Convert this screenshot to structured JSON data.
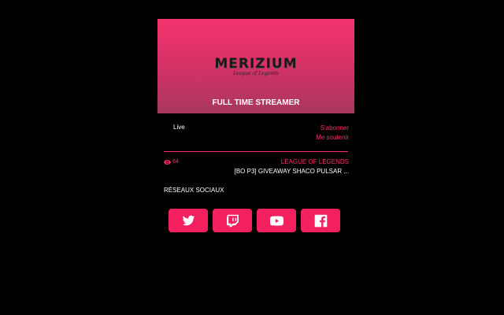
{
  "banner": {
    "logo_text": "MERIZIUM",
    "logo_subtitle": "League of Legends",
    "tagline": "FULL TIME STREAMER"
  },
  "status": {
    "live_label": "Live"
  },
  "actions": {
    "subscribe_label": "S'abonner",
    "support_label": "Me soutenir"
  },
  "stream": {
    "viewers": "64",
    "game": "LEAGUE OF LEGENDS",
    "title": "[BO P3] GIVEAWAY SHACO PULSAR ..."
  },
  "socials": {
    "title": "RÉSEAUX SOCIAUX",
    "items": [
      {
        "icon": "twitter-icon"
      },
      {
        "icon": "twitch-icon"
      },
      {
        "icon": "youtube-icon"
      },
      {
        "icon": "facebook-icon"
      }
    ]
  },
  "colors": {
    "accent": "#ff2e6e",
    "button": "#f2205f",
    "background": "#000000",
    "banner_top": "#f5346f",
    "banner_bottom": "#a9385e"
  }
}
